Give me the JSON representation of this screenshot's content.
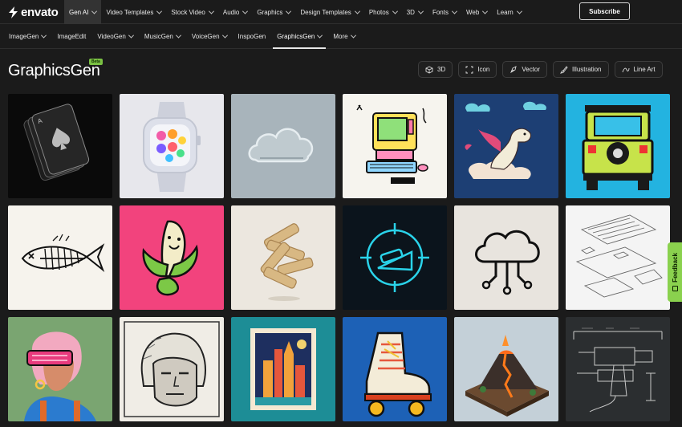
{
  "brand": {
    "name": "envato"
  },
  "topnav": {
    "items": [
      {
        "label": "Gen AI"
      },
      {
        "label": "Video Templates"
      },
      {
        "label": "Stock Video"
      },
      {
        "label": "Audio"
      },
      {
        "label": "Graphics"
      },
      {
        "label": "Design Templates"
      },
      {
        "label": "Photos"
      },
      {
        "label": "3D"
      },
      {
        "label": "Fonts"
      },
      {
        "label": "Web"
      },
      {
        "label": "Learn"
      }
    ],
    "subscribe_label": "Subscribe"
  },
  "subnav": {
    "items": [
      {
        "label": "ImageGen"
      },
      {
        "label": "ImageEdit"
      },
      {
        "label": "VideoGen"
      },
      {
        "label": "MusicGen"
      },
      {
        "label": "VoiceGen"
      },
      {
        "label": "InspoGen"
      },
      {
        "label": "GraphicsGen"
      },
      {
        "label": "More"
      }
    ]
  },
  "page": {
    "title": "GraphicsGen",
    "badge": "Beta"
  },
  "filters": [
    {
      "label": "3D",
      "icon": "cube-icon"
    },
    {
      "label": "Icon",
      "icon": "icon-frame-icon"
    },
    {
      "label": "Vector",
      "icon": "pen-nib-icon"
    },
    {
      "label": "Illustration",
      "icon": "brush-icon"
    },
    {
      "label": "Line Art",
      "icon": "line-art-icon"
    }
  ],
  "feedback": {
    "label": "Feedback"
  },
  "colors": {
    "background": "#1b1b1b",
    "accent_green": "#8ad14e"
  }
}
